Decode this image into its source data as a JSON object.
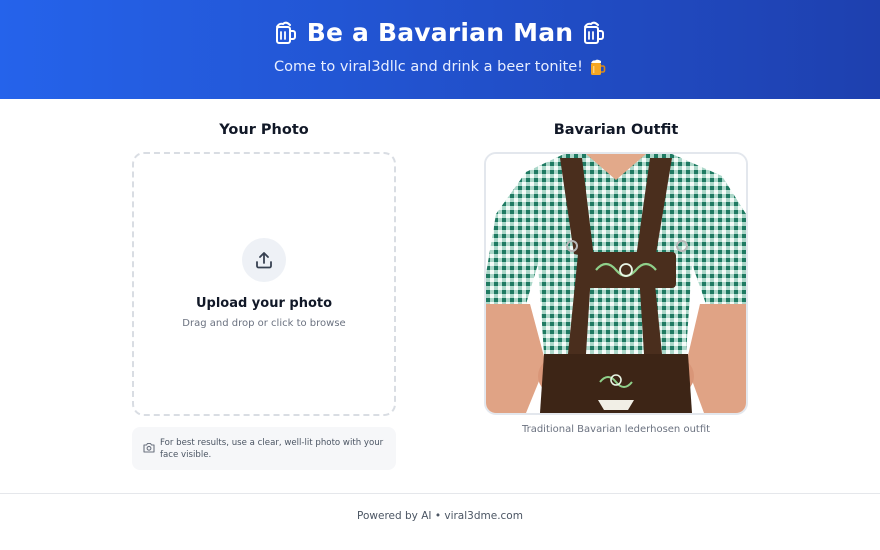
{
  "header": {
    "title": "Be a Bavarian Man",
    "subtitle": "Come to viral3dllc and drink a beer tonite!",
    "title_icon": "beer-mug-icon",
    "subtitle_icon": "beer-emoji-icon",
    "gradient": [
      "#2563eb",
      "#1e40af"
    ]
  },
  "upload": {
    "section_title": "Your Photo",
    "drop_title": "Upload your photo",
    "drop_subtitle": "Drag and drop or click to browse",
    "icon": "upload-icon",
    "tip": "For best results, use a clear, well-lit photo with your face visible.",
    "tip_icon": "camera-icon"
  },
  "outfit": {
    "section_title": "Bavarian Outfit",
    "caption": "Traditional Bavarian lederhosen outfit"
  },
  "footer": {
    "text": "Powered by AI • viral3dme.com"
  }
}
